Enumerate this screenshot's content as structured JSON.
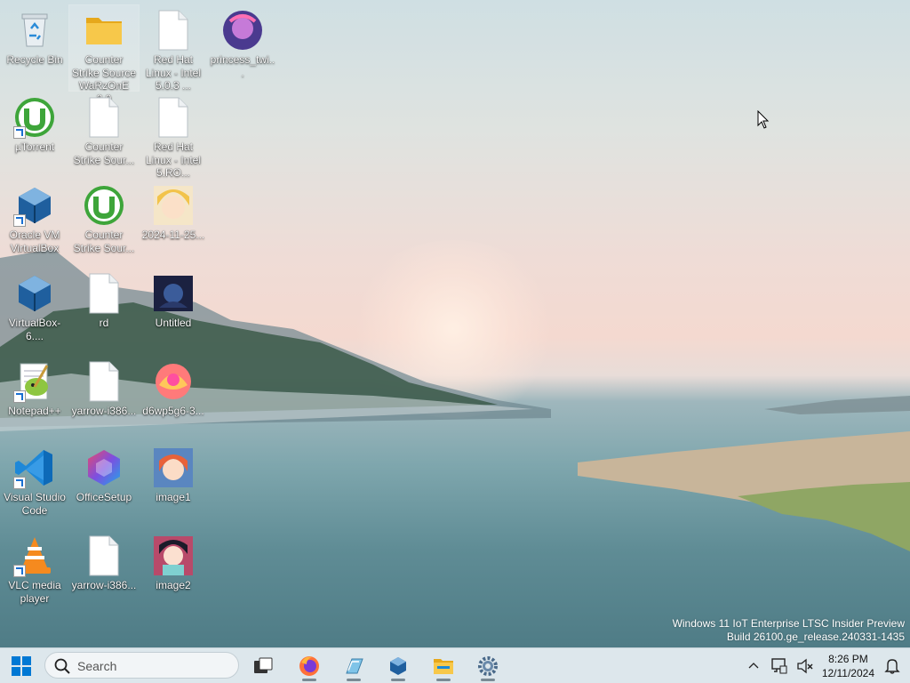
{
  "desktop": {
    "icons": [
      {
        "label": "Recycle Bin",
        "icon": "recycle-bin-icon"
      },
      {
        "label": "Counter Strike Source WaRzOnE 2.0",
        "icon": "folder-icon"
      },
      {
        "label": "Red Hat Linux - Intel 5.0.3 ...",
        "icon": "file-icon"
      },
      {
        "label": "princess_twi...",
        "icon": "image-thumbnail-icon"
      },
      {
        "label": "µTorrent",
        "icon": "utorrent-icon"
      },
      {
        "label": "Counter Strike Sour...",
        "icon": "file-icon"
      },
      {
        "label": "Red Hat Linux - Intel 5.RO...",
        "icon": "file-icon"
      },
      {
        "label": "Oracle VM VirtualBox",
        "icon": "virtualbox-icon"
      },
      {
        "label": "Counter Strike Sour...",
        "icon": "utorrent-icon"
      },
      {
        "label": "2024-11-25...",
        "icon": "image-thumbnail-icon"
      },
      {
        "label": "VirtualBox-6....",
        "icon": "virtualbox-icon"
      },
      {
        "label": "rd",
        "icon": "file-icon"
      },
      {
        "label": "Untitled",
        "icon": "image-thumbnail-icon"
      },
      {
        "label": "Notepad++",
        "icon": "notepadpp-icon"
      },
      {
        "label": "yarrow-i386...",
        "icon": "file-icon"
      },
      {
        "label": "d6wp5g6-3...",
        "icon": "image-thumbnail-icon"
      },
      {
        "label": "Visual Studio Code",
        "icon": "vscode-icon"
      },
      {
        "label": "OfficeSetup",
        "icon": "office-icon"
      },
      {
        "label": "image1",
        "icon": "image-thumbnail-icon"
      },
      {
        "label": "VLC media player",
        "icon": "vlc-icon"
      },
      {
        "label": "yarrow-i386...",
        "icon": "file-icon"
      },
      {
        "label": "image2",
        "icon": "image-thumbnail-icon"
      }
    ],
    "watermark_line1": "Windows 11 IoT Enterprise LTSC Insider Preview",
    "watermark_line2": "Build 26100.ge_release.240331-1435"
  },
  "taskbar": {
    "search_placeholder": "Search",
    "apps": [
      "start-icon",
      "task-view-icon",
      "firefox-icon",
      "virtualbox-manager-icon",
      "virtualbox-icon",
      "file-explorer-icon",
      "settings-icon"
    ],
    "clock_time": "8:26 PM",
    "clock_date": "12/11/2024"
  },
  "colors": {
    "taskbar_bg": "#dde7ec",
    "accent": "#0067c0"
  }
}
